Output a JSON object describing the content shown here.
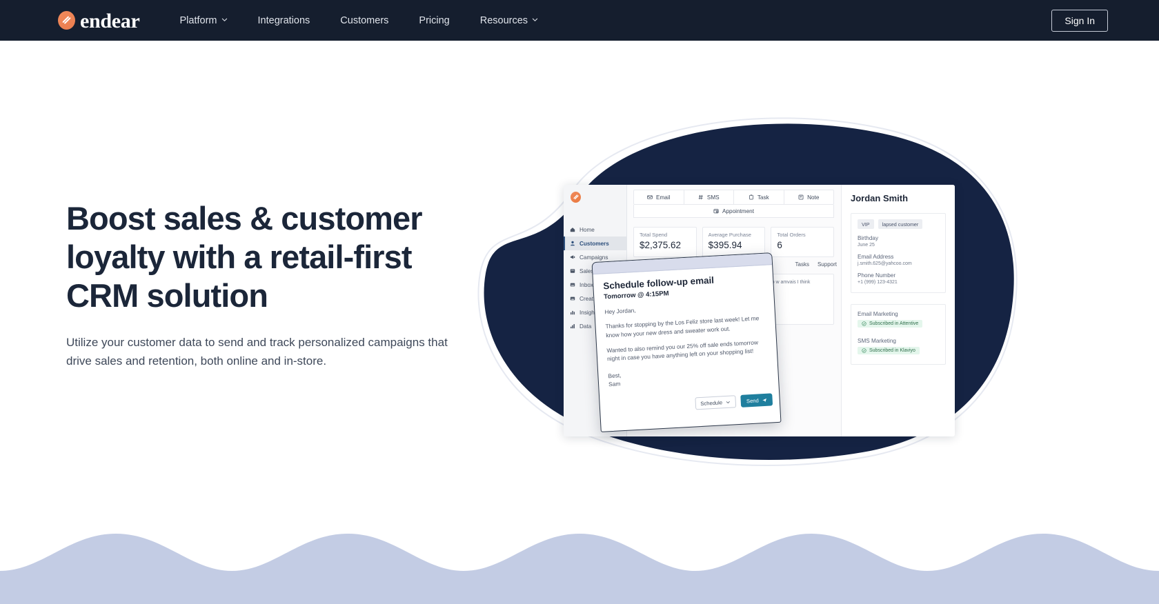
{
  "nav": {
    "brand": "endear",
    "brand_icon": "endear-logo-icon",
    "links": [
      {
        "label": "Platform",
        "has_caret": true
      },
      {
        "label": "Integrations",
        "has_caret": false
      },
      {
        "label": "Customers",
        "has_caret": false
      },
      {
        "label": "Pricing",
        "has_caret": false
      },
      {
        "label": "Resources",
        "has_caret": true
      }
    ],
    "sign_in": "Sign In"
  },
  "hero": {
    "title": "Boost sales & customer loyalty with a retail-first CRM solution",
    "subtitle": "Utilize your customer data to send and track personalized campaigns that drive sales and retention, both online and in-store."
  },
  "mockup": {
    "sidebar": [
      {
        "label": "Home",
        "icon": "home-icon",
        "active": false
      },
      {
        "label": "Customers",
        "icon": "person-icon",
        "active": true
      },
      {
        "label": "Campaigns",
        "icon": "megaphone-icon",
        "active": false
      },
      {
        "label": "SalesChat",
        "icon": "chat-icon",
        "active": false
      },
      {
        "label": "Inbox",
        "icon": "inbox-icon",
        "active": false
      },
      {
        "label": "Creative",
        "icon": "image-icon",
        "active": false
      },
      {
        "label": "Insights",
        "icon": "bar-chart-icon",
        "active": false
      },
      {
        "label": "Data",
        "icon": "data-icon",
        "active": false
      }
    ],
    "compose_tabs": [
      {
        "label": "Email",
        "icon": "envelope-icon"
      },
      {
        "label": "SMS",
        "icon": "hash-icon"
      },
      {
        "label": "Task",
        "icon": "clipboard-icon"
      },
      {
        "label": "Note",
        "icon": "note-icon"
      }
    ],
    "compose_secondary": {
      "label": "Appointment",
      "icon": "calendar-icon"
    },
    "stats": [
      {
        "label": "Total Spend",
        "value": "$2,375.62"
      },
      {
        "label": "Average Purchase",
        "value": "$395.94"
      },
      {
        "label": "Total Orders",
        "value": "6"
      }
    ],
    "sub_tabs": [
      "Tasks",
      "Support"
    ],
    "note_snippet": "I just wanted to\nw amvais I think",
    "detail": {
      "name": "Jordan Smith",
      "chips": [
        "VIP",
        "lapsed customer"
      ],
      "fields": [
        {
          "label": "Birthday",
          "value": "June 25"
        },
        {
          "label": "Email Address",
          "value": "j.smith.625@yahcoo.com"
        },
        {
          "label": "Phone Number",
          "value": "+1 (999) 123-4321"
        }
      ],
      "marketing": [
        {
          "label": "Email Marketing",
          "status": "Subscribed in Attentive"
        },
        {
          "label": "SMS Marketing",
          "status": "Subscribed in Klaviyo"
        }
      ]
    }
  },
  "email_card": {
    "title": "Schedule follow-up email",
    "time": "Tomorrow @ 4:15PM",
    "greeting": "Hey Jordan,",
    "paragraph1": "Thanks for stopping by the Los Feliz store last week! Let me know how your new dress and sweater work out.",
    "paragraph2": "Wanted to also remind you our 25% off sale ends tomorrow night in case you have anything left on your shopping list!",
    "signature_1": "Best,",
    "signature_2": "Sam",
    "schedule_label": "Schedule",
    "send_label": "Send"
  },
  "colors": {
    "nav_bg": "#151e2e",
    "blob": "#152343",
    "brand_orange": "#ea7d4e",
    "heading": "#1b2639",
    "wave": "#c3cce4",
    "send_button": "#1f7f9e"
  }
}
